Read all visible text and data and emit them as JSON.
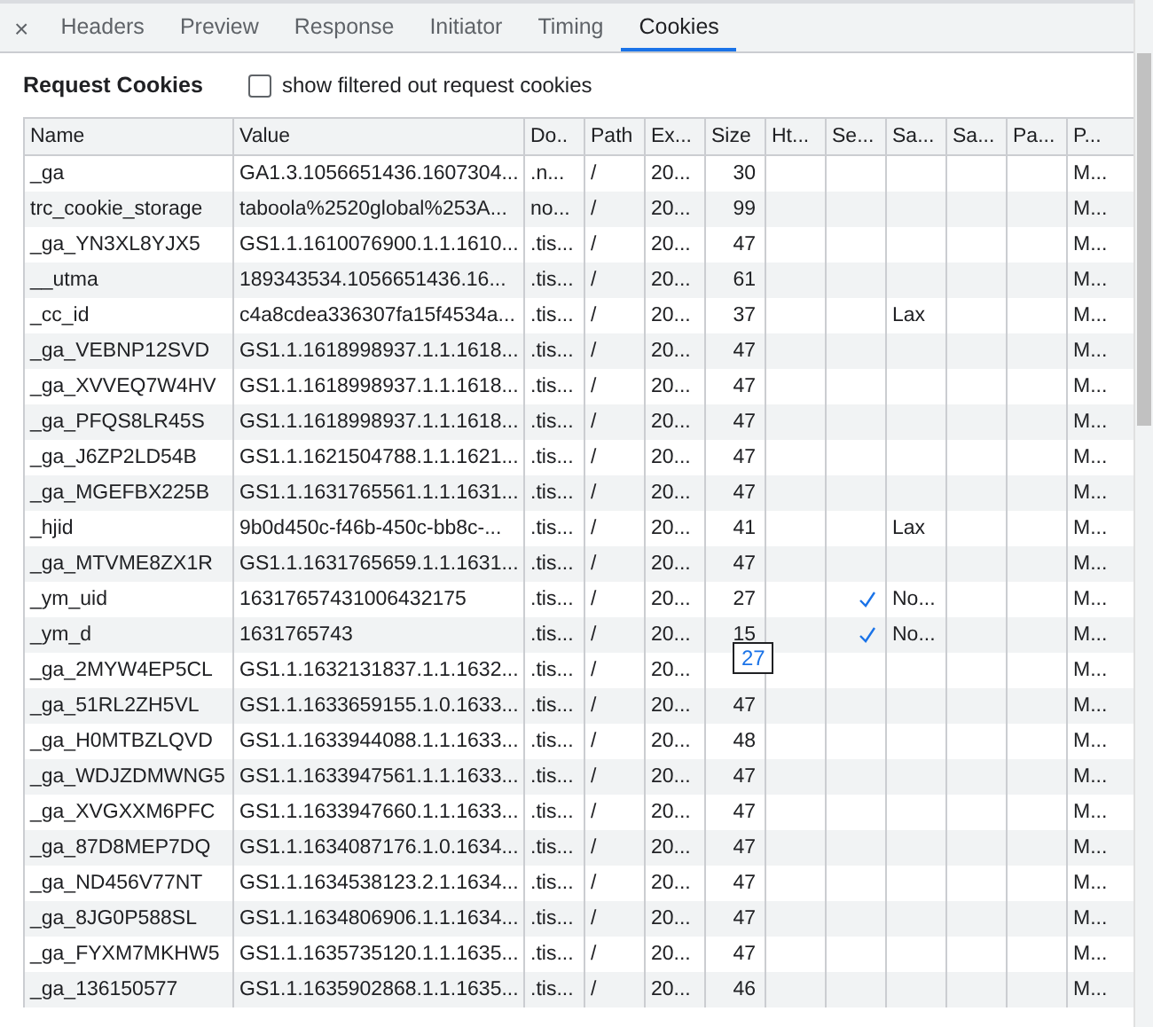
{
  "tabs": [
    {
      "label": "Headers",
      "selected": false
    },
    {
      "label": "Preview",
      "selected": false
    },
    {
      "label": "Response",
      "selected": false
    },
    {
      "label": "Initiator",
      "selected": false
    },
    {
      "label": "Timing",
      "selected": false
    },
    {
      "label": "Cookies",
      "selected": true
    }
  ],
  "close_glyph": "×",
  "section_title": "Request Cookies",
  "filter_checkbox": {
    "label": "show filtered out request cookies",
    "checked": false
  },
  "table": {
    "columns": [
      "Name",
      "Value",
      "Do..",
      "Path",
      "Ex...",
      "Size",
      "Ht...",
      "Se...",
      "Sa...",
      "Sa...",
      "Pa...",
      "P..."
    ],
    "rows": [
      {
        "name": "_ga",
        "value": "GA1.3.1056651436.1607304...",
        "domain": ".n...",
        "path": "/",
        "expires": "20...",
        "size": "30",
        "secure": false,
        "samesite": "",
        "priority": "M..."
      },
      {
        "name": "trc_cookie_storage",
        "value": "taboola%2520global%253A...",
        "domain": "no...",
        "path": "/",
        "expires": "20...",
        "size": "99",
        "secure": false,
        "samesite": "",
        "priority": "M..."
      },
      {
        "name": "_ga_YN3XL8YJX5",
        "value": "GS1.1.1610076900.1.1.1610...",
        "domain": ".tis...",
        "path": "/",
        "expires": "20...",
        "size": "47",
        "secure": false,
        "samesite": "",
        "priority": "M..."
      },
      {
        "name": "__utma",
        "value": "189343534.1056651436.16...",
        "domain": ".tis...",
        "path": "/",
        "expires": "20...",
        "size": "61",
        "secure": false,
        "samesite": "",
        "priority": "M..."
      },
      {
        "name": "_cc_id",
        "value": "c4a8cdea336307fa15f4534a...",
        "domain": ".tis...",
        "path": "/",
        "expires": "20...",
        "size": "37",
        "secure": false,
        "samesite": "Lax",
        "priority": "M..."
      },
      {
        "name": "_ga_VEBNP12SVD",
        "value": "GS1.1.1618998937.1.1.1618...",
        "domain": ".tis...",
        "path": "/",
        "expires": "20...",
        "size": "47",
        "secure": false,
        "samesite": "",
        "priority": "M..."
      },
      {
        "name": "_ga_XVVEQ7W4HV",
        "value": "GS1.1.1618998937.1.1.1618...",
        "domain": ".tis...",
        "path": "/",
        "expires": "20...",
        "size": "47",
        "secure": false,
        "samesite": "",
        "priority": "M..."
      },
      {
        "name": "_ga_PFQS8LR45S",
        "value": "GS1.1.1618998937.1.1.1618...",
        "domain": ".tis...",
        "path": "/",
        "expires": "20...",
        "size": "47",
        "secure": false,
        "samesite": "",
        "priority": "M..."
      },
      {
        "name": "_ga_J6ZP2LD54B",
        "value": "GS1.1.1621504788.1.1.1621...",
        "domain": ".tis...",
        "path": "/",
        "expires": "20...",
        "size": "47",
        "secure": false,
        "samesite": "",
        "priority": "M..."
      },
      {
        "name": "_ga_MGEFBX225B",
        "value": "GS1.1.1631765561.1.1.1631...",
        "domain": ".tis...",
        "path": "/",
        "expires": "20...",
        "size": "47",
        "secure": false,
        "samesite": "",
        "priority": "M..."
      },
      {
        "name": "_hjid",
        "value": "9b0d450c-f46b-450c-bb8c-...",
        "domain": ".tis...",
        "path": "/",
        "expires": "20...",
        "size": "41",
        "secure": false,
        "samesite": "Lax",
        "priority": "M..."
      },
      {
        "name": "_ga_MTVME8ZX1R",
        "value": "GS1.1.1631765659.1.1.1631...",
        "domain": ".tis...",
        "path": "/",
        "expires": "20...",
        "size": "47",
        "secure": false,
        "samesite": "",
        "priority": "M..."
      },
      {
        "name": "_ym_uid",
        "value": "16317657431006432175",
        "domain": ".tis...",
        "path": "/",
        "expires": "20...",
        "size": "27",
        "secure": true,
        "samesite": "No...",
        "priority": "M..."
      },
      {
        "name": "_ym_d",
        "value": "1631765743",
        "domain": ".tis...",
        "path": "/",
        "expires": "20...",
        "size": "15",
        "secure": true,
        "samesite": "No...",
        "priority": "M..."
      },
      {
        "name": "_ga_2MYW4EP5CL",
        "value": "GS1.1.1632131837.1.1.1632...",
        "domain": ".tis...",
        "path": "/",
        "expires": "20...",
        "size": "",
        "secure": false,
        "samesite": "",
        "priority": "M..."
      },
      {
        "name": "_ga_51RL2ZH5VL",
        "value": "GS1.1.1633659155.1.0.1633...",
        "domain": ".tis...",
        "path": "/",
        "expires": "20...",
        "size": "47",
        "secure": false,
        "samesite": "",
        "priority": "M..."
      },
      {
        "name": "_ga_H0MTBZLQVD",
        "value": "GS1.1.1633944088.1.1.1633...",
        "domain": ".tis...",
        "path": "/",
        "expires": "20...",
        "size": "48",
        "secure": false,
        "samesite": "",
        "priority": "M..."
      },
      {
        "name": "_ga_WDJZDMWNG5",
        "value": "GS1.1.1633947561.1.1.1633...",
        "domain": ".tis...",
        "path": "/",
        "expires": "20...",
        "size": "47",
        "secure": false,
        "samesite": "",
        "priority": "M..."
      },
      {
        "name": "_ga_XVGXXM6PFC",
        "value": "GS1.1.1633947660.1.1.1633...",
        "domain": ".tis...",
        "path": "/",
        "expires": "20...",
        "size": "47",
        "secure": false,
        "samesite": "",
        "priority": "M..."
      },
      {
        "name": "_ga_87D8MEP7DQ",
        "value": "GS1.1.1634087176.1.0.1634...",
        "domain": ".tis...",
        "path": "/",
        "expires": "20...",
        "size": "47",
        "secure": false,
        "samesite": "",
        "priority": "M..."
      },
      {
        "name": "_ga_ND456V77NT",
        "value": "GS1.1.1634538123.2.1.1634...",
        "domain": ".tis...",
        "path": "/",
        "expires": "20...",
        "size": "47",
        "secure": false,
        "samesite": "",
        "priority": "M..."
      },
      {
        "name": "_ga_8JG0P588SL",
        "value": "GS1.1.1634806906.1.1.1634...",
        "domain": ".tis...",
        "path": "/",
        "expires": "20...",
        "size": "47",
        "secure": false,
        "samesite": "",
        "priority": "M..."
      },
      {
        "name": "_ga_FYXM7MKHW5",
        "value": "GS1.1.1635735120.1.1.1635...",
        "domain": ".tis...",
        "path": "/",
        "expires": "20...",
        "size": "47",
        "secure": false,
        "samesite": "",
        "priority": "M..."
      },
      {
        "name": "_ga_136150577",
        "value": "GS1.1.1635902868.1.1.1635...",
        "domain": ".tis...",
        "path": "/",
        "expires": "20...",
        "size": "46",
        "secure": false,
        "samesite": "",
        "priority": "M..."
      }
    ]
  },
  "tooltip": {
    "text": "27"
  }
}
